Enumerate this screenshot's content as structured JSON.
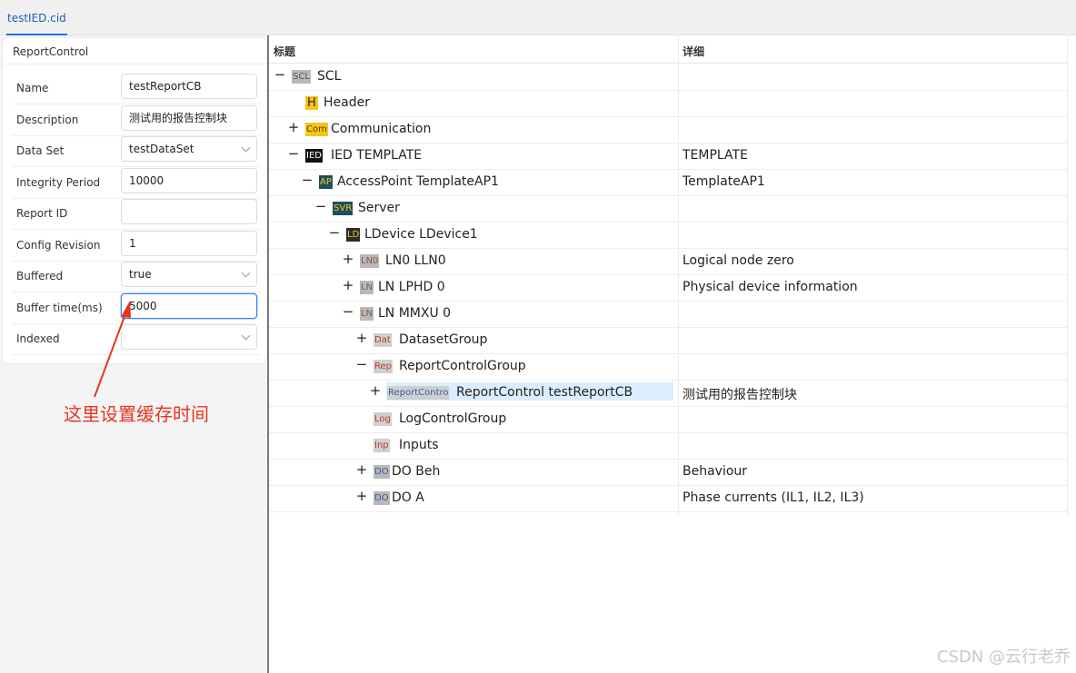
{
  "tab": {
    "label": "testIED.cid"
  },
  "panel": {
    "title": "ReportControl",
    "fields": [
      {
        "label": "Name",
        "value": "testReportCB",
        "type": "text"
      },
      {
        "label": "Description",
        "value": "测试用的报告控制块",
        "type": "text"
      },
      {
        "label": "Data Set",
        "value": "testDataSet",
        "type": "select"
      },
      {
        "label": "Integrity Period",
        "value": "10000",
        "type": "text"
      },
      {
        "label": "Report ID",
        "value": "",
        "type": "text"
      },
      {
        "label": "Config Revision",
        "value": "1",
        "type": "text"
      },
      {
        "label": "Buffered",
        "value": "true",
        "type": "select"
      },
      {
        "label": "Buffer time(ms)",
        "value": "5000",
        "type": "text",
        "focused": true
      },
      {
        "label": "Indexed",
        "value": "",
        "type": "select"
      }
    ]
  },
  "annotation": {
    "text": "这里设置缓存时间",
    "color": "#e8341c"
  },
  "grid": {
    "columns": [
      "标题",
      "详细"
    ],
    "rows": [
      {
        "level": 0,
        "toggle": "−",
        "icon": "SCL",
        "icon_bg": "#b9b9b9",
        "icon_fg": "#555555",
        "text": "SCL",
        "detail": ""
      },
      {
        "level": 1,
        "toggle": "",
        "icon": "H",
        "icon_bg": "#f5c518",
        "icon_fg": "#222222",
        "text": "Header",
        "detail": ""
      },
      {
        "level": 1,
        "toggle": "+",
        "icon": "Com",
        "icon_bg": "#f5c518",
        "icon_fg": "#5a3b00",
        "text": "Communication",
        "detail": ""
      },
      {
        "level": 1,
        "toggle": "−",
        "icon": "IED",
        "icon_bg": "#111111",
        "icon_fg": "#ffffff",
        "text": "IED TEMPLATE",
        "detail": "TEMPLATE"
      },
      {
        "level": 2,
        "toggle": "−",
        "icon": "AP",
        "icon_bg": "#1f4e5f",
        "icon_fg": "#f5c518",
        "text": "AccessPoint TemplateAP1",
        "detail": "TemplateAP1"
      },
      {
        "level": 3,
        "toggle": "−",
        "icon": "SVR",
        "icon_bg": "#1f4e5f",
        "icon_fg": "#f5c518",
        "text": "Server",
        "detail": ""
      },
      {
        "level": 4,
        "toggle": "−",
        "icon": "LD",
        "icon_bg": "#2b2b2b",
        "icon_fg": "#f5c518",
        "text": "LDevice LDevice1",
        "detail": ""
      },
      {
        "level": 5,
        "toggle": "+",
        "icon": "LN0",
        "icon_bg": "#b9b9b9",
        "icon_fg": "#8a5a3c",
        "text": "LN0 LLN0",
        "detail": "Logical node zero"
      },
      {
        "level": 5,
        "toggle": "+",
        "icon": "LN",
        "icon_bg": "#b9b9b9",
        "icon_fg": "#8a5a3c",
        "text": "LN LPHD 0",
        "detail": "Physical device information"
      },
      {
        "level": 5,
        "toggle": "−",
        "icon": "LN",
        "icon_bg": "#b9b9b9",
        "icon_fg": "#8a5a3c",
        "text": "LN MMXU 0",
        "detail": ""
      },
      {
        "level": 6,
        "toggle": "+",
        "icon": "Dat",
        "icon_bg": "#cfcfcf",
        "icon_fg": "#c0392b",
        "text": "DatasetGroup",
        "detail": ""
      },
      {
        "level": 6,
        "toggle": "−",
        "icon": "Rep",
        "icon_bg": "#cfcfcf",
        "icon_fg": "#c0392b",
        "text": "ReportControlGroup",
        "detail": ""
      },
      {
        "level": 7,
        "toggle": "+",
        "icon": "ReportControl",
        "icon_bg": "#cfcfcf",
        "icon_fg": "#3b5ba0",
        "text": "ReportControl testReportCB",
        "detail": "测试用的报告控制块",
        "selected": true
      },
      {
        "level": 6,
        "toggle": "",
        "icon": "Log",
        "icon_bg": "#cfcfcf",
        "icon_fg": "#c0392b",
        "text": "LogControlGroup",
        "detail": ""
      },
      {
        "level": 6,
        "toggle": "",
        "icon": "Inp",
        "icon_bg": "#cfcfcf",
        "icon_fg": "#c0392b",
        "text": "Inputs",
        "detail": ""
      },
      {
        "level": 6,
        "toggle": "+",
        "icon": "DO",
        "icon_bg": "#b9b9b9",
        "icon_fg": "#3b5ba0",
        "text": "DO Beh",
        "detail": "Behaviour"
      },
      {
        "level": 6,
        "toggle": "+",
        "icon": "DO",
        "icon_bg": "#b9b9b9",
        "icon_fg": "#3b5ba0",
        "text": "DO A",
        "detail": "Phase currents (IL1, IL2, IL3)"
      }
    ]
  },
  "watermark": "CSDN @云行老乔"
}
